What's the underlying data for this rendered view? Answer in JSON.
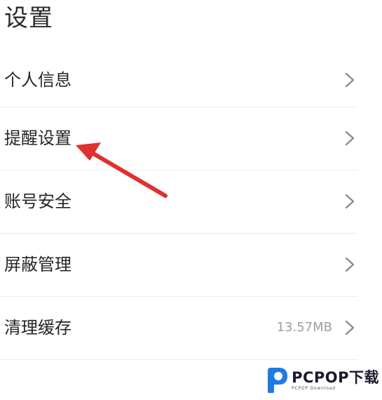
{
  "header": {
    "title": "设置"
  },
  "settings": {
    "items": [
      {
        "label": "个人信息",
        "value": ""
      },
      {
        "label": "提醒设置",
        "value": ""
      },
      {
        "label": "账号安全",
        "value": ""
      },
      {
        "label": "屏蔽管理",
        "value": ""
      },
      {
        "label": "清理缓存",
        "value": "13.57MB"
      }
    ],
    "chevron_icon": "chevron-right-icon"
  },
  "annotation": {
    "arrow_icon": "red-pointer-arrow",
    "color": "#e0302f"
  },
  "watermark": {
    "brand": "PCPOP下载",
    "sub": "PCPOP Download",
    "logo_icon": "pcpop-logo",
    "logo_color": "#1e7be6"
  }
}
